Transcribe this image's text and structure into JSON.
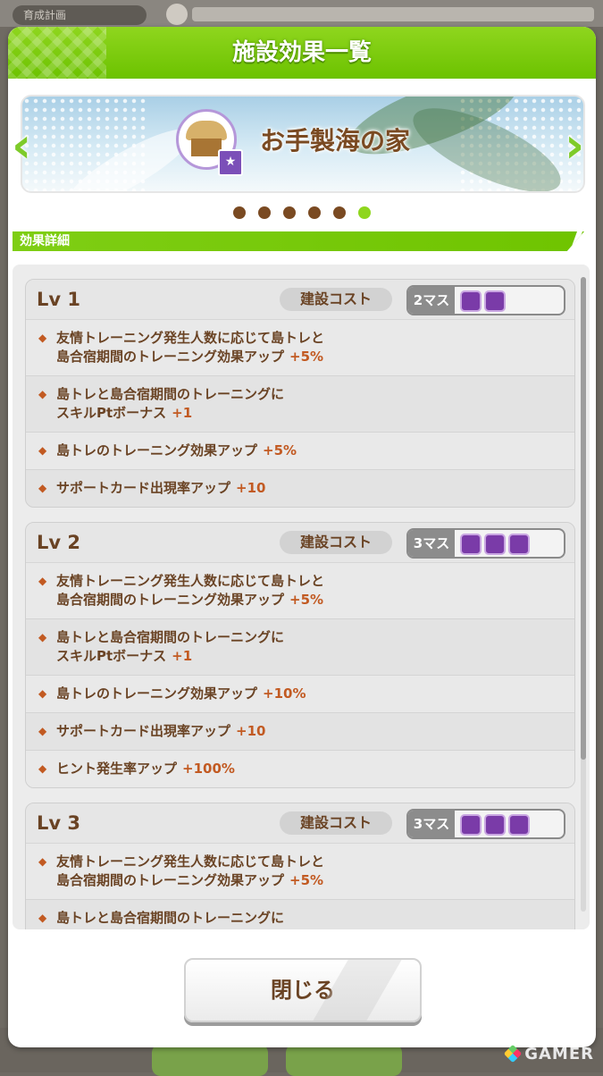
{
  "background": {
    "top_label": "育成計画"
  },
  "modal": {
    "title": "施設効果一覧"
  },
  "banner": {
    "facility_name": "お手製海の家"
  },
  "section_label": "効果詳細",
  "cost_label": "建設コスト",
  "levels": [
    {
      "label": "Lv 1",
      "cost": "2マス",
      "slots": 2,
      "effects": [
        {
          "text": "友情トレーニング発生人数に応じて島トレと\n島合宿期間のトレーニング効果アップ",
          "value": "+5%"
        },
        {
          "text": "島トレと島合宿期間のトレーニングに\nスキルPtボーナス",
          "value": "+1"
        },
        {
          "text": "島トレのトレーニング効果アップ",
          "value": "+5%"
        },
        {
          "text": "サポートカード出現率アップ",
          "value": "+10"
        }
      ]
    },
    {
      "label": "Lv 2",
      "cost": "3マス",
      "slots": 3,
      "effects": [
        {
          "text": "友情トレーニング発生人数に応じて島トレと\n島合宿期間のトレーニング効果アップ",
          "value": "+5%"
        },
        {
          "text": "島トレと島合宿期間のトレーニングに\nスキルPtボーナス",
          "value": "+1"
        },
        {
          "text": "島トレのトレーニング効果アップ",
          "value": "+10%"
        },
        {
          "text": "サポートカード出現率アップ",
          "value": "+10"
        },
        {
          "text": "ヒント発生率アップ",
          "value": "+100%"
        }
      ]
    },
    {
      "label": "Lv 3",
      "cost": "3マス",
      "slots": 3,
      "effects": [
        {
          "text": "友情トレーニング発生人数に応じて島トレと\n島合宿期間のトレーニング効果アップ",
          "value": "+5%"
        },
        {
          "text": "島トレと島合宿期間のトレーニングに",
          "value": ""
        }
      ]
    }
  ],
  "pager": {
    "count": 6,
    "active_index": 5
  },
  "close_button": "閉じる",
  "watermark": "GAMER",
  "colors": {
    "accent_green": "#7fce14",
    "text_brown": "#6a4324",
    "value_orange": "#c25a22",
    "slot_purple": "#7a3ba8"
  },
  "icons": [
    "chevron-left-icon",
    "chevron-right-icon",
    "beach-hut-icon",
    "star-badge-icon",
    "diamond-bullet-icon"
  ]
}
